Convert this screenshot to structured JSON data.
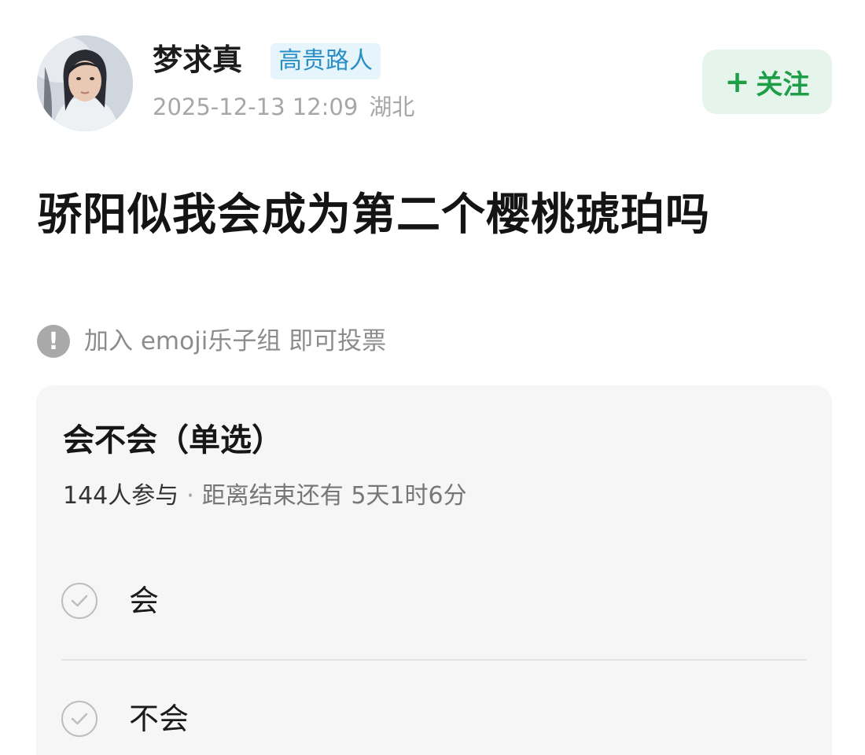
{
  "user": {
    "name": "梦求真",
    "badge": "高贵路人",
    "datetime": "2025-12-13 12:09",
    "location": "湖北"
  },
  "follow_button": {
    "plus": "+",
    "label": "关注"
  },
  "post": {
    "title": "骄阳似我会成为第二个樱桃琥珀吗"
  },
  "notice": {
    "icon": "!",
    "text": "加入 emoji乐子组 即可投票"
  },
  "poll": {
    "title": "会不会（单选）",
    "participants": "144人参与",
    "separator": "·",
    "remaining": "距离结束还有 5天1时6分",
    "options": [
      {
        "label": "会"
      },
      {
        "label": "不会"
      }
    ]
  },
  "colors": {
    "badge_bg": "#e6f4fb",
    "badge_text": "#2a8fc4",
    "follow_bg": "#e5f5eb",
    "follow_text": "#1f9e48",
    "card_bg": "#f6f6f6"
  }
}
